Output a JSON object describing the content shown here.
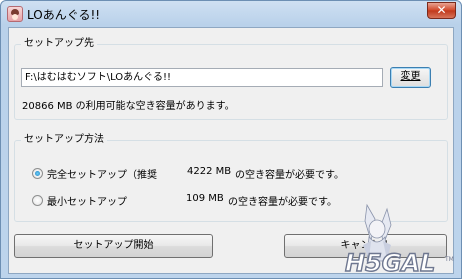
{
  "window": {
    "title": "LOあんぐる!!",
    "close_symbol": "✕"
  },
  "setup_destination": {
    "group_title": "セットアップ先",
    "path": "F:\\はむはむソフト\\LOあんぐる!!",
    "change_label": "変更",
    "free_space_text": "20866 MB の利用可能な空き容量があります。"
  },
  "setup_method": {
    "group_title": "セットアップ方法",
    "options": [
      {
        "label": "完全セットアップ（推奨",
        "size": "4222 MB",
        "need_text": "の空き容量が必要です。",
        "selected": true
      },
      {
        "label": "最小セットアップ",
        "size": "109 MB",
        "need_text": "の空き容量が必要です。",
        "selected": false
      }
    ]
  },
  "buttons": {
    "start_label": "セットアップ開始",
    "cancel_label": "キャンセル"
  },
  "watermark": {
    "text": "H5GAL",
    "suffix": "TM"
  }
}
